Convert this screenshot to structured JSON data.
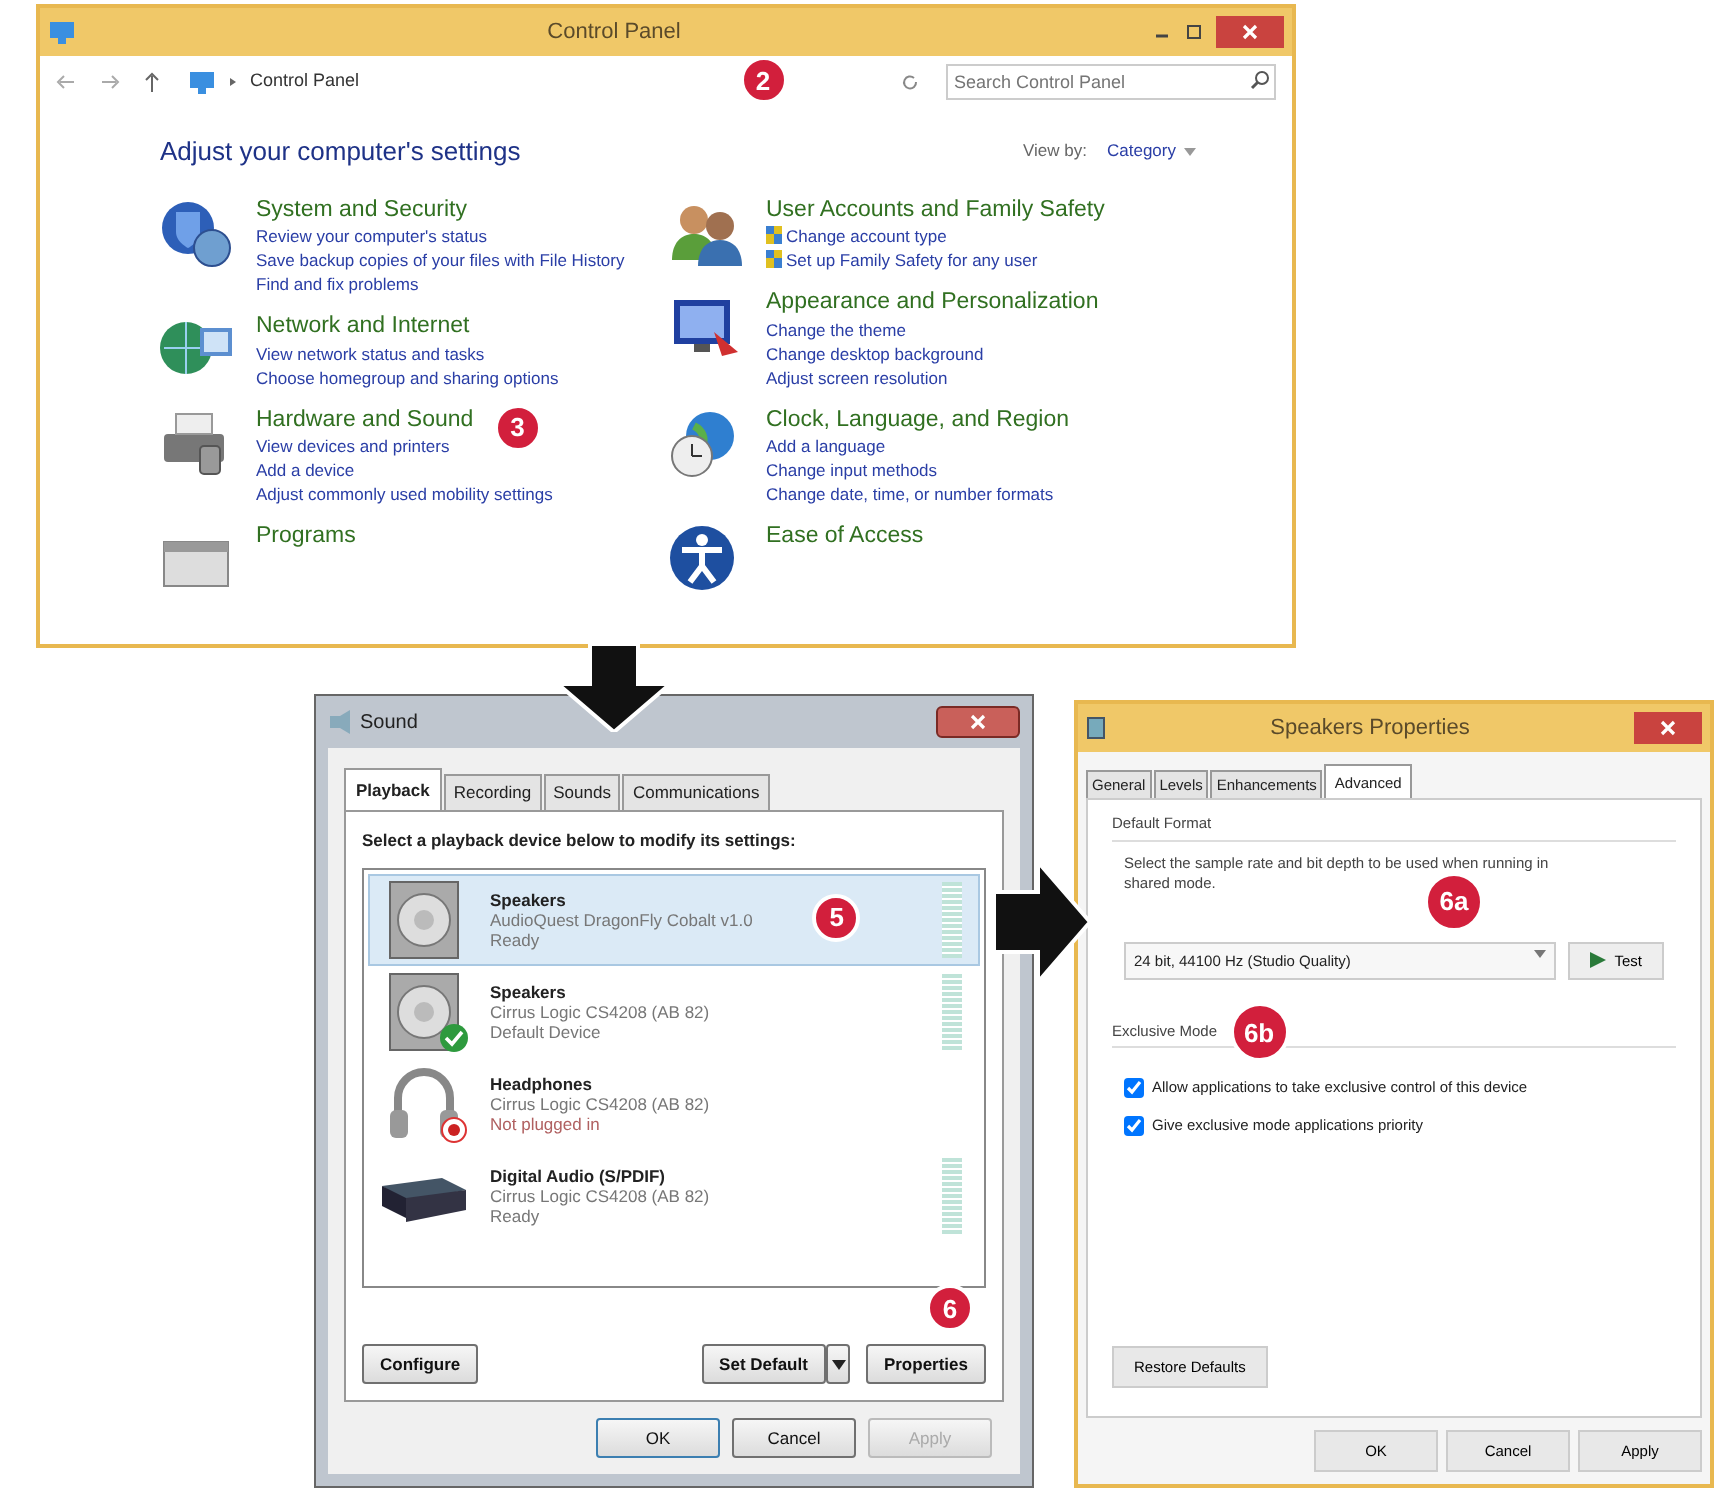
{
  "control_panel": {
    "title": "Control Panel",
    "address": "Control Panel",
    "search": {
      "placeholder": "Search Control Panel"
    },
    "heading": "Adjust your computer's settings",
    "view_by_label": "View by:",
    "view_by_value": "Category",
    "columns": [
      [
        {
          "kind": "security",
          "title": "System and Security",
          "links": [
            {
              "text": "Review your computer's status",
              "shield": false
            },
            {
              "text": "Save backup copies of your files with File History",
              "shield": false
            },
            {
              "text": "Find and fix problems",
              "shield": false
            }
          ]
        },
        {
          "kind": "network",
          "title": "Network and Internet",
          "links": [
            {
              "text": "View network status and tasks",
              "shield": false
            },
            {
              "text": "Choose homegroup and sharing options",
              "shield": false
            }
          ]
        },
        {
          "kind": "hardware",
          "title": "Hardware and Sound",
          "links": [
            {
              "text": "View devices and printers",
              "shield": false
            },
            {
              "text": "Add a device",
              "shield": false
            },
            {
              "text": "Adjust commonly used mobility settings",
              "shield": false
            }
          ]
        },
        {
          "kind": "programs",
          "title": "Programs"
        }
      ],
      [
        {
          "kind": "users",
          "title": "User Accounts and Family Safety",
          "links": [
            {
              "text": "Change account type",
              "shield": true
            },
            {
              "text": "Set up Family Safety for any user",
              "shield": true
            }
          ]
        },
        {
          "kind": "appearance",
          "title": "Appearance and Personalization",
          "links": [
            {
              "text": "Change the theme",
              "shield": false
            },
            {
              "text": "Change desktop background",
              "shield": false
            },
            {
              "text": "Adjust screen resolution",
              "shield": false
            }
          ]
        },
        {
          "kind": "clock",
          "title": "Clock, Language, and Region",
          "links": [
            {
              "text": "Add a language",
              "shield": false
            },
            {
              "text": "Change input methods",
              "shield": false
            },
            {
              "text": "Change date, time, or number formats",
              "shield": false
            }
          ]
        },
        {
          "kind": "access",
          "title": "Ease of Access"
        }
      ]
    ]
  },
  "sound": {
    "title": "Sound",
    "tabs": [
      {
        "label": "Playback",
        "selected": true
      },
      {
        "label": "Recording",
        "selected": false
      },
      {
        "label": "Sounds",
        "selected": false
      },
      {
        "label": "Communications",
        "selected": false
      }
    ],
    "instruction": "Select a playback device below to modify its settings:",
    "devices": [
      {
        "kind": "speaker",
        "name": "Speakers",
        "driver": "AudioQuest DragonFly Cobalt v1.0",
        "status": "Ready",
        "is_default": false,
        "unplugged": false,
        "meter": true,
        "selected": true
      },
      {
        "kind": "speaker",
        "name": "Speakers",
        "driver": "Cirrus Logic CS4208 (AB 82)",
        "status": "Default Device",
        "is_default": true,
        "unplugged": false,
        "meter": true,
        "selected": false
      },
      {
        "kind": "headphones",
        "name": "Headphones",
        "driver": "Cirrus Logic CS4208 (AB 82)",
        "status": "Not plugged in",
        "is_default": false,
        "unplugged": true,
        "meter": false,
        "selected": false
      },
      {
        "kind": "digital",
        "name": "Digital Audio (S/PDIF)",
        "driver": "Cirrus Logic CS4208 (AB 82)",
        "status": "Ready",
        "is_default": false,
        "unplugged": false,
        "meter": true,
        "selected": false
      }
    ],
    "configure": "Configure",
    "set_default": "Set Default",
    "properties": "Properties",
    "footer": [
      {
        "label": "OK",
        "disabled": false
      },
      {
        "label": "Cancel",
        "disabled": false
      },
      {
        "label": "Apply",
        "disabled": true
      }
    ]
  },
  "properties": {
    "title": "Speakers Properties",
    "tabs": [
      {
        "label": "General",
        "selected": false
      },
      {
        "label": "Levels",
        "selected": false
      },
      {
        "label": "Enhancements",
        "selected": false
      },
      {
        "label": "Advanced",
        "selected": true
      }
    ],
    "format_group": "Default Format",
    "format_text": "Select the sample rate and bit depth to be used when running in shared mode.",
    "format_value": "24 bit, 44100 Hz (Studio Quality)",
    "test": "Test",
    "exclusive_group": "Exclusive Mode",
    "options": [
      {
        "label": "Allow applications to take exclusive control of this device",
        "checked": true
      },
      {
        "label": "Give exclusive mode applications priority",
        "checked": true
      }
    ],
    "restore": "Restore Defaults",
    "footer": [
      {
        "label": "OK",
        "disabled": false
      },
      {
        "label": "Cancel",
        "disabled": false
      },
      {
        "label": "Apply",
        "disabled": false
      }
    ]
  },
  "callouts": [
    {
      "label": "2"
    },
    {
      "label": "3"
    },
    {
      "label": "5"
    },
    {
      "label": "6"
    },
    {
      "label": "6a"
    },
    {
      "label": "6b"
    }
  ]
}
